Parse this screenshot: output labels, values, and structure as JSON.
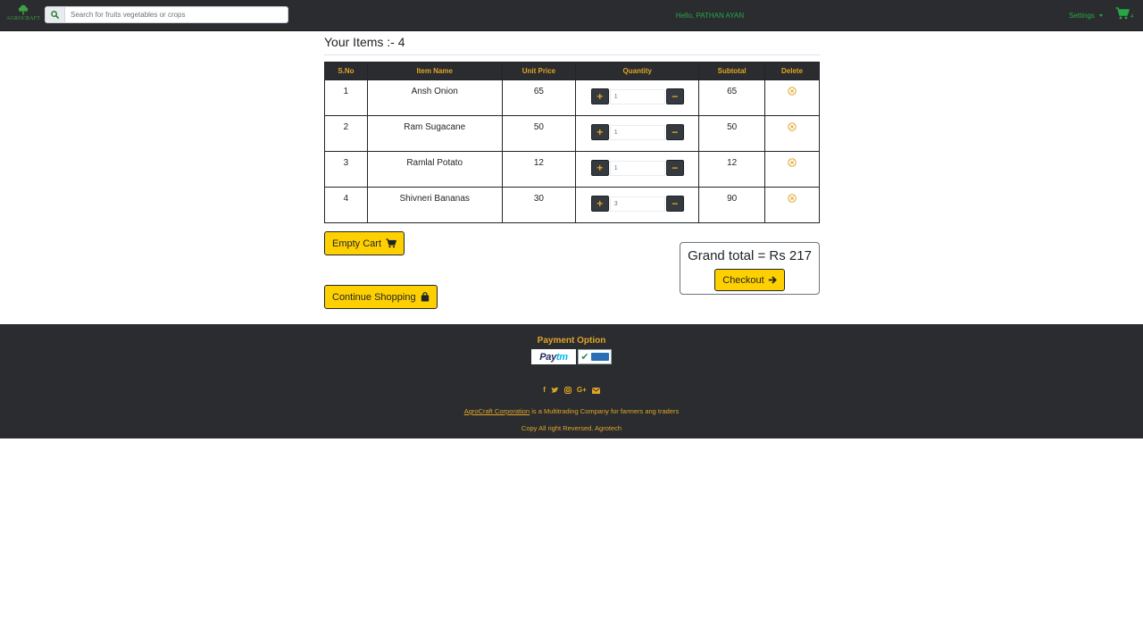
{
  "nav": {
    "brand": "AGROCRAFT",
    "search_placeholder": "Search for fruits vegetables or crops",
    "greeting": "Hello, PATHAN AYAN",
    "settings_label": "Settings",
    "cart_count": "4"
  },
  "cart": {
    "items_title": "Your Items :- 4",
    "columns": [
      "S.No",
      "Item Name",
      "Unit Price",
      "Quantity",
      "Subtotal",
      "Delete"
    ],
    "rows": [
      {
        "sno": "1",
        "name": "Ansh Onion",
        "price": "65",
        "qty": "1",
        "subtotal": "65"
      },
      {
        "sno": "2",
        "name": "Ram Sugacane",
        "price": "50",
        "qty": "1",
        "subtotal": "50"
      },
      {
        "sno": "3",
        "name": "Ramlal Potato",
        "price": "12",
        "qty": "1",
        "subtotal": "12"
      },
      {
        "sno": "4",
        "name": "Shivneri Bananas",
        "price": "30",
        "qty": "3",
        "subtotal": "90"
      }
    ],
    "empty_label": "Empty Cart",
    "continue_label": "Continue Shopping",
    "grand_total": "Grand total = Rs 217",
    "checkout_label": "Checkout"
  },
  "footer": {
    "payment_title": "Payment Option",
    "paytm_a": "Pay",
    "paytm_b": "tm",
    "company": "AgroCraft Corporation",
    "tagline": " is a Multitrading Company for farmers ang traders",
    "copyright": "Copy All right Reversed.  Agrotech",
    "social_icons": [
      "facebook-icon",
      "twitter-icon",
      "instagram-icon",
      "google-plus-icon",
      "envelope-icon"
    ]
  },
  "colors": {
    "navbar_bg": "#2a2c2f",
    "accent_gold": "#e0a526",
    "button_yellow": "#ffd000",
    "green": "#28a745"
  }
}
